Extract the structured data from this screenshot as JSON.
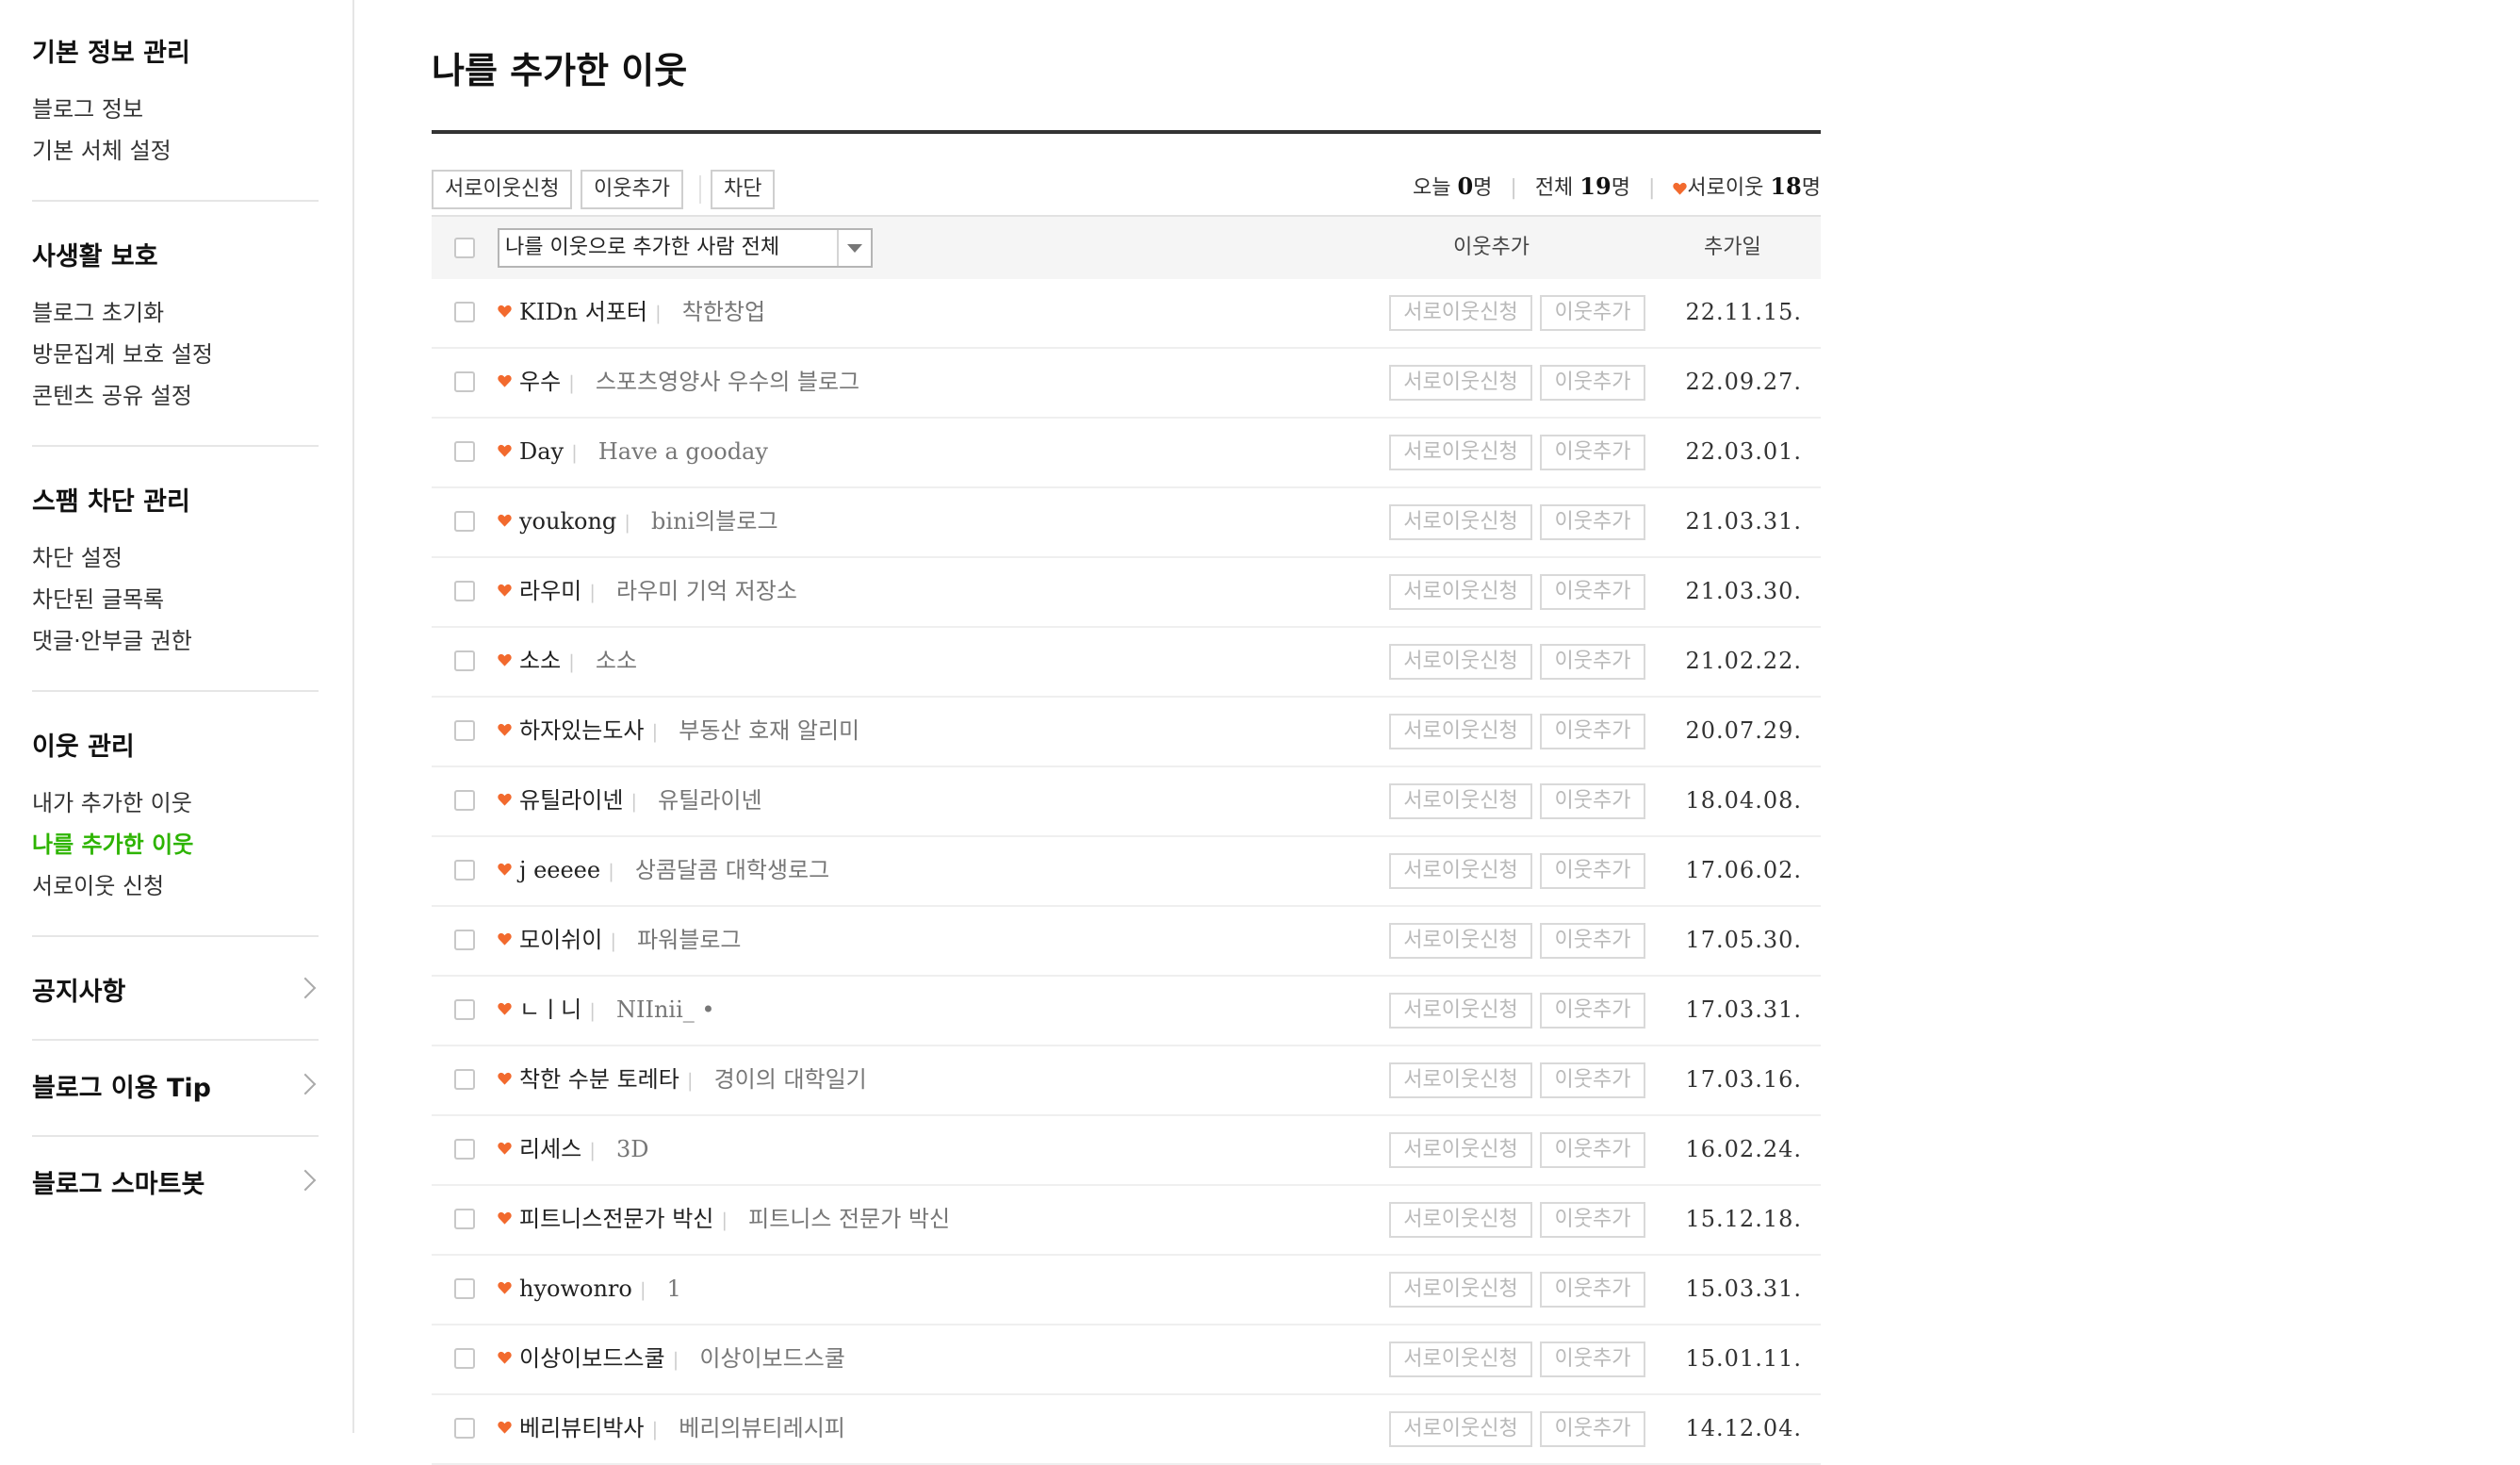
{
  "sidebar": {
    "sections": [
      {
        "title": "기본 정보 관리",
        "items": [
          {
            "label": "블로그 정보"
          },
          {
            "label": "기본 서체 설정"
          }
        ]
      },
      {
        "title": "사생활 보호",
        "items": [
          {
            "label": "블로그 초기화"
          },
          {
            "label": "방문집계 보호 설정"
          },
          {
            "label": "콘텐츠 공유 설정"
          }
        ]
      },
      {
        "title": "스팸 차단 관리",
        "items": [
          {
            "label": "차단 설정"
          },
          {
            "label": "차단된 글목록"
          },
          {
            "label": "댓글·안부글 권한"
          }
        ]
      },
      {
        "title": "이웃 관리",
        "items": [
          {
            "label": "내가 추가한 이웃"
          },
          {
            "label": "나를 추가한 이웃",
            "active": true
          },
          {
            "label": "서로이웃 신청"
          }
        ]
      }
    ],
    "links": [
      {
        "label": "공지사항"
      },
      {
        "label": "블로그 이용 Tip"
      },
      {
        "label": "블로그 스마트봇"
      }
    ]
  },
  "page": {
    "title": "나를 추가한 이웃"
  },
  "toolbar": {
    "mutual_label": "서로이웃신청",
    "add_label": "이웃추가",
    "block_label": "차단"
  },
  "stats": {
    "today_label": "오늘",
    "today_count": "0",
    "today_unit": "명",
    "total_label": "전체",
    "total_count": "19",
    "total_unit": "명",
    "mutual_label": "서로이웃",
    "mutual_count": "18",
    "mutual_unit": "명"
  },
  "table": {
    "filter_value": "나를 이웃으로 추가한 사람 전체",
    "col_add": "이웃추가",
    "col_date": "추가일",
    "mutual_btn": "서로이웃신청",
    "add_btn": "이웃추가",
    "rows": [
      {
        "name": "KIDn 서포터",
        "blog": "착한창업",
        "date": "22.11.15."
      },
      {
        "name": "우수",
        "blog": "스포츠영양사 우수의 블로그",
        "date": "22.09.27."
      },
      {
        "name": "Day",
        "blog": "Have a gooday",
        "date": "22.03.01."
      },
      {
        "name": "youkong",
        "blog": "bini의블로그",
        "date": "21.03.31."
      },
      {
        "name": "라우미",
        "blog": "라우미 기억 저장소",
        "date": "21.03.30."
      },
      {
        "name": "소소",
        "blog": "소소",
        "date": "21.02.22."
      },
      {
        "name": "하자있는도사",
        "blog": "부동산 호재 알리미",
        "date": "20.07.29."
      },
      {
        "name": "유틸라이넨",
        "blog": "유틸라이넨",
        "date": "18.04.08."
      },
      {
        "name": "j eeeee",
        "blog": "상콤달콤 대학생로그",
        "date": "17.06.02."
      },
      {
        "name": "모이쉬이",
        "blog": "파워블로그",
        "date": "17.05.30."
      },
      {
        "name": "ㄴㅣ니",
        "blog": "NIInii_ •",
        "date": "17.03.31."
      },
      {
        "name": "착한 수분 토레타",
        "blog": "경이의 대학일기",
        "date": "17.03.16."
      },
      {
        "name": "리세스",
        "blog": "3D",
        "date": "16.02.24."
      },
      {
        "name": "피트니스전문가 박신",
        "blog": "피트니스 전문가 박신",
        "date": "15.12.18."
      },
      {
        "name": "hyowonro",
        "blog": "1",
        "date": "15.03.31."
      },
      {
        "name": "이상이보드스쿨",
        "blog": "이상이보드스쿨",
        "date": "15.01.11."
      },
      {
        "name": "베리뷰티박사",
        "blog": "베리의뷰티레시피",
        "date": "14.12.04."
      }
    ]
  },
  "colors": {
    "accent_green": "#2db400",
    "heart_orange": "#f26a2e"
  },
  "icons": {
    "heart": "heart-icon",
    "chevron": "chevron-right-icon",
    "dropdown": "triangle-down-icon"
  }
}
